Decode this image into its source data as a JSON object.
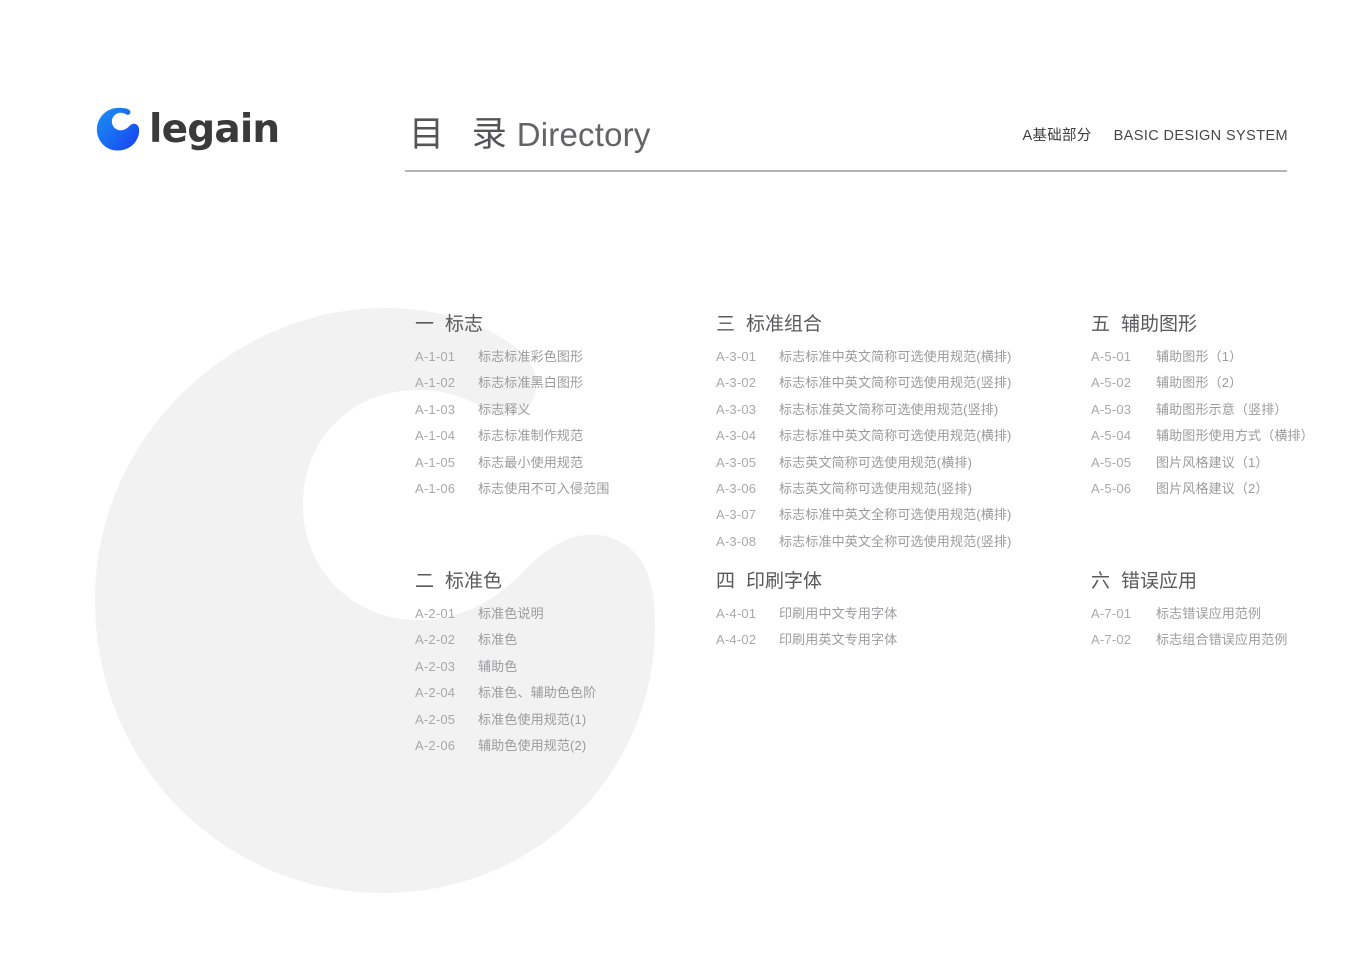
{
  "brand": {
    "logo_icon": "legain-g-mark-icon",
    "wordmark": "legain",
    "logo_color_start": "#1b8ef2",
    "logo_color_end": "#1a46f0"
  },
  "header": {
    "title_cn": "目 录",
    "title_en": "Directory",
    "section_cn": "A基础部分",
    "section_en": "BASIC DESIGN SYSTEM",
    "rule_color": "#b3b3b5"
  },
  "watermark": {
    "icon": "legain-g-watermark-icon",
    "color": "#f2f2f2"
  },
  "directory": {
    "sections": [
      {
        "num": "一",
        "title": "标志",
        "entries": [
          {
            "code": "A-1-01",
            "desc": "标志标准彩色图形"
          },
          {
            "code": "A-1-02",
            "desc": "标志标准黑白图形"
          },
          {
            "code": "A-1-03",
            "desc": "标志释义"
          },
          {
            "code": "A-1-04",
            "desc": "标志标准制作规范"
          },
          {
            "code": "A-1-05",
            "desc": "标志最小使用规范"
          },
          {
            "code": "A-1-06",
            "desc": "标志使用不可入侵范围"
          }
        ]
      },
      {
        "num": "二",
        "title": "标准色",
        "entries": [
          {
            "code": "A-2-01",
            "desc": "标准色说明"
          },
          {
            "code": "A-2-02",
            "desc": "标准色"
          },
          {
            "code": "A-2-03",
            "desc": "辅助色"
          },
          {
            "code": "A-2-04",
            "desc": "标准色、辅助色色阶"
          },
          {
            "code": "A-2-05",
            "desc": "标准色使用规范(1)"
          },
          {
            "code": "A-2-06",
            "desc": "辅助色使用规范(2)"
          }
        ]
      },
      {
        "num": "三",
        "title": "标准组合",
        "entries": [
          {
            "code": "A-3-01",
            "desc": "标志标准中英文简称可选使用规范(横排)"
          },
          {
            "code": "A-3-02",
            "desc": "标志标准中英文简称可选使用规范(竖排)"
          },
          {
            "code": "A-3-03",
            "desc": "标志标准英文简称可选使用规范(竖排)"
          },
          {
            "code": "A-3-04",
            "desc": "标志标准中英文简称可选使用规范(横排)"
          },
          {
            "code": "A-3-05",
            "desc": "标志英文简称可选使用规范(横排)"
          },
          {
            "code": "A-3-06",
            "desc": "标志英文简称可选使用规范(竖排)"
          },
          {
            "code": "A-3-07",
            "desc": "标志标准中英文全称可选使用规范(横排)"
          },
          {
            "code": "A-3-08",
            "desc": "标志标准中英文全称可选使用规范(竖排)"
          }
        ]
      },
      {
        "num": "四",
        "title": "印刷字体",
        "entries": [
          {
            "code": "A-4-01",
            "desc": "印刷用中文专用字体"
          },
          {
            "code": "A-4-02",
            "desc": "印刷用英文专用字体"
          }
        ]
      },
      {
        "num": "五",
        "title": "辅助图形",
        "entries": [
          {
            "code": "A-5-01",
            "desc": "辅助图形（1）"
          },
          {
            "code": "A-5-02",
            "desc": "辅助图形（2）"
          },
          {
            "code": "A-5-03",
            "desc": "辅助图形示意（竖排）"
          },
          {
            "code": "A-5-04",
            "desc": "辅助图形使用方式（横排）"
          },
          {
            "code": "A-5-05",
            "desc": "图片风格建议（1）"
          },
          {
            "code": "A-5-06",
            "desc": "图片风格建议（2）"
          }
        ]
      },
      {
        "num": "六",
        "title": "错误应用",
        "entries": [
          {
            "code": "A-7-01",
            "desc": "标志错误应用范例"
          },
          {
            "code": "A-7-02",
            "desc": "标志组合错误应用范例"
          }
        ]
      }
    ]
  }
}
